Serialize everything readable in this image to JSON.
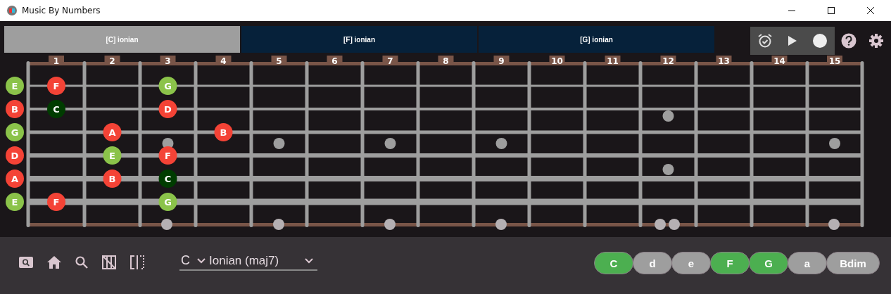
{
  "window": {
    "title": "Music By Numbers"
  },
  "tabs": [
    {
      "label": "[C] ionian",
      "selected": true
    },
    {
      "label": "[F] ionian",
      "selected": false
    },
    {
      "label": "[G] ionian",
      "selected": false
    }
  ],
  "fretboard": {
    "fret_numbers": [
      "1",
      "2",
      "3",
      "4",
      "5",
      "6",
      "7",
      "8",
      "9",
      "10",
      "11",
      "12",
      "13",
      "14",
      "15"
    ],
    "strings": [
      {
        "positions": [
          {
            "kind": "note",
            "note": "E",
            "color": "#8bc34a"
          },
          {
            "kind": "note",
            "note": "F",
            "color": "#f44336"
          },
          {
            "kind": "empty"
          },
          {
            "kind": "note",
            "note": "G",
            "color": "#8bc34a"
          },
          {
            "kind": "empty"
          },
          {
            "kind": "empty"
          },
          {
            "kind": "empty"
          },
          {
            "kind": "empty"
          },
          {
            "kind": "empty"
          },
          {
            "kind": "empty"
          },
          {
            "kind": "empty"
          },
          {
            "kind": "empty"
          },
          {
            "kind": "empty"
          },
          {
            "kind": "empty"
          },
          {
            "kind": "empty"
          },
          {
            "kind": "empty"
          }
        ]
      },
      {
        "positions": [
          {
            "kind": "note",
            "note": "B",
            "color": "#f44336"
          },
          {
            "kind": "note",
            "note": "C",
            "color": "#003c00"
          },
          {
            "kind": "empty"
          },
          {
            "kind": "note",
            "note": "D",
            "color": "#f44336"
          },
          {
            "kind": "empty"
          },
          {
            "kind": "empty"
          },
          {
            "kind": "empty"
          },
          {
            "kind": "empty"
          },
          {
            "kind": "empty"
          },
          {
            "kind": "empty"
          },
          {
            "kind": "empty"
          },
          {
            "kind": "empty"
          },
          {
            "kind": "empty"
          },
          {
            "kind": "empty"
          },
          {
            "kind": "empty"
          },
          {
            "kind": "empty"
          }
        ]
      },
      {
        "positions": [
          {
            "kind": "note",
            "note": "G",
            "color": "#8bc34a"
          },
          {
            "kind": "empty"
          },
          {
            "kind": "note",
            "note": "A",
            "color": "#f44336"
          },
          {
            "kind": "empty"
          },
          {
            "kind": "note",
            "note": "B",
            "color": "#f44336"
          },
          {
            "kind": "empty"
          },
          {
            "kind": "empty"
          },
          {
            "kind": "empty"
          },
          {
            "kind": "empty"
          },
          {
            "kind": "empty"
          },
          {
            "kind": "empty"
          },
          {
            "kind": "empty"
          },
          {
            "kind": "empty"
          },
          {
            "kind": "empty"
          },
          {
            "kind": "empty"
          },
          {
            "kind": "empty"
          }
        ]
      },
      {
        "positions": [
          {
            "kind": "note",
            "note": "D",
            "color": "#f44336"
          },
          {
            "kind": "empty"
          },
          {
            "kind": "note",
            "note": "E",
            "color": "#8bc34a"
          },
          {
            "kind": "note",
            "note": "F",
            "color": "#f44336"
          },
          {
            "kind": "empty"
          },
          {
            "kind": "empty"
          },
          {
            "kind": "empty"
          },
          {
            "kind": "empty"
          },
          {
            "kind": "empty"
          },
          {
            "kind": "empty"
          },
          {
            "kind": "empty"
          },
          {
            "kind": "empty"
          },
          {
            "kind": "empty"
          },
          {
            "kind": "empty"
          },
          {
            "kind": "empty"
          },
          {
            "kind": "empty"
          }
        ]
      },
      {
        "positions": [
          {
            "kind": "note",
            "note": "A",
            "color": "#f44336"
          },
          {
            "kind": "empty"
          },
          {
            "kind": "note",
            "note": "B",
            "color": "#f44336"
          },
          {
            "kind": "note",
            "note": "C",
            "color": "#003c00"
          },
          {
            "kind": "empty"
          },
          {
            "kind": "empty"
          },
          {
            "kind": "empty"
          },
          {
            "kind": "empty"
          },
          {
            "kind": "empty"
          },
          {
            "kind": "empty"
          },
          {
            "kind": "empty"
          },
          {
            "kind": "empty"
          },
          {
            "kind": "empty"
          },
          {
            "kind": "empty"
          },
          {
            "kind": "empty"
          },
          {
            "kind": "empty"
          }
        ]
      },
      {
        "positions": [
          {
            "kind": "note",
            "note": "E",
            "color": "#8bc34a"
          },
          {
            "kind": "note",
            "note": "F",
            "color": "#f44336"
          },
          {
            "kind": "empty"
          },
          {
            "kind": "note",
            "note": "G",
            "color": "#8bc34a"
          },
          {
            "kind": "empty"
          },
          {
            "kind": "empty"
          },
          {
            "kind": "empty"
          },
          {
            "kind": "empty"
          },
          {
            "kind": "empty"
          },
          {
            "kind": "empty"
          },
          {
            "kind": "empty"
          },
          {
            "kind": "empty"
          },
          {
            "kind": "empty"
          },
          {
            "kind": "empty"
          },
          {
            "kind": "empty"
          },
          {
            "kind": "empty"
          }
        ]
      }
    ]
  },
  "scale": {
    "key": "C",
    "mode": "Ionian (maj7)"
  },
  "chords": [
    {
      "label": "C",
      "selected": true
    },
    {
      "label": "d",
      "selected": false
    },
    {
      "label": "e",
      "selected": false
    },
    {
      "label": "F",
      "selected": true
    },
    {
      "label": "G",
      "selected": true
    },
    {
      "label": "a",
      "selected": false
    },
    {
      "label": "Bdim",
      "selected": false
    }
  ]
}
